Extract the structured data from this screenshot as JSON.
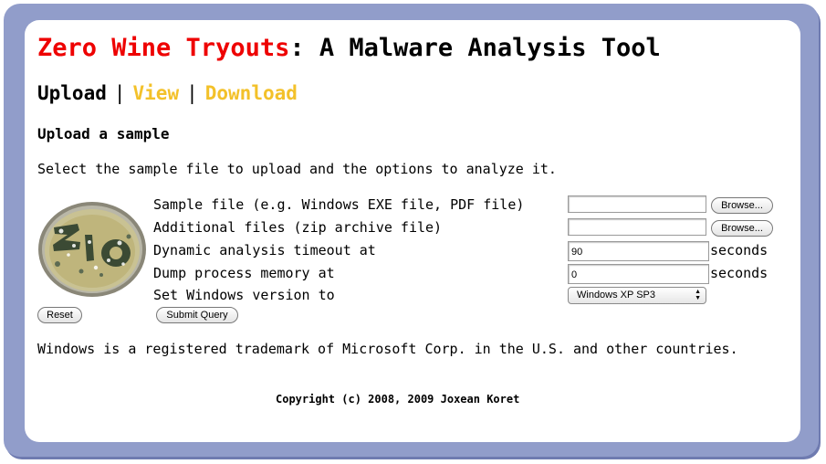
{
  "header": {
    "title_red": "Zero Wine Tryouts",
    "title_rest": ": A Malware Analysis Tool"
  },
  "nav": {
    "upload": "Upload",
    "separator": "|",
    "view": "View",
    "download": "Download"
  },
  "section_title": "Upload a sample",
  "intro": "Select the sample file to upload and the options to analyze it.",
  "form": {
    "sample_file_label": "Sample file (e.g. Windows EXE file, PDF file)",
    "sample_file_value": "",
    "additional_files_label": "Additional files (zip archive file)",
    "additional_files_value": "",
    "browse_label": "Browse...",
    "timeout_label": "Dynamic analysis timeout at",
    "timeout_value": "90",
    "timeout_unit": "seconds",
    "dump_label": "Dump process memory at",
    "dump_value": "0",
    "dump_unit": "seconds",
    "version_label": "Set Windows version to",
    "version_value": "Windows XP SP3",
    "reset_label": "Reset",
    "submit_label": "Submit Query"
  },
  "logo": {
    "icon": "petri-dish-logo"
  },
  "trademark": "Windows is a registered trademark of Microsoft Corp. in the U.S. and other countries.",
  "copyright": "Copyright (c) 2008, 2009 Joxean Koret",
  "colors": {
    "frame": "#919dca",
    "title_accent": "#ee0000",
    "nav_link": "#f3c12a"
  }
}
